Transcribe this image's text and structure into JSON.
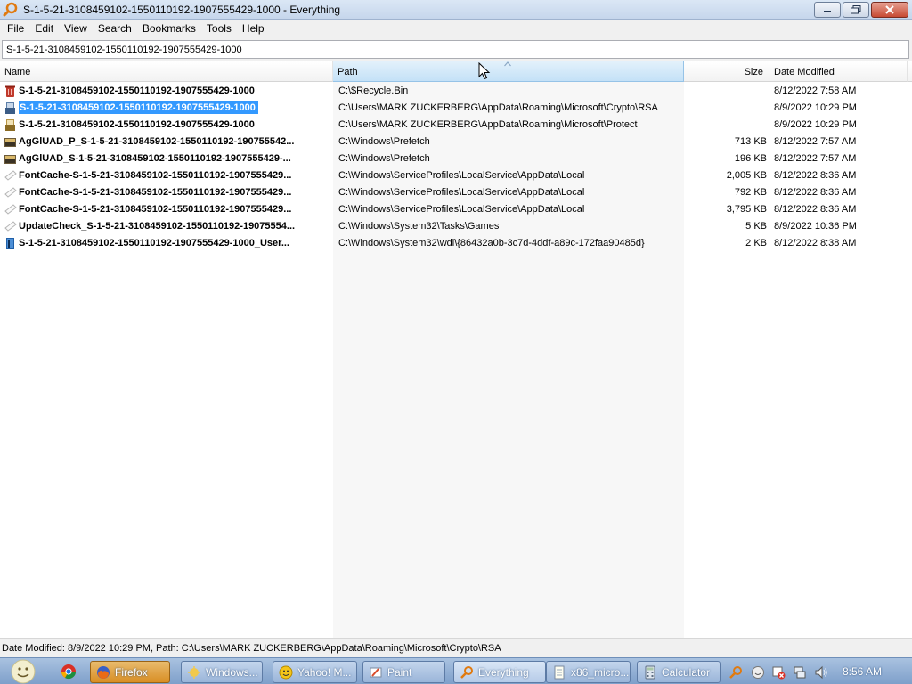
{
  "window": {
    "title": "S-1-5-21-3108459102-1550110192-1907555429-1000 - Everything"
  },
  "menu": [
    "File",
    "Edit",
    "View",
    "Search",
    "Bookmarks",
    "Tools",
    "Help"
  ],
  "search": {
    "value": "S-1-5-21-3108459102-1550110192-1907555429-1000"
  },
  "columns": {
    "name": "Name",
    "path": "Path",
    "size": "Size",
    "date": "Date Modified",
    "sorted_by": "Path"
  },
  "rows": [
    {
      "name": "S-1-5-21-3108459102-1550110192-1907555429-1000",
      "path": "C:\\$Recycle.Bin",
      "size": "",
      "date": "8/12/2022 7:58 AM",
      "icon": "recycle-bin-icon"
    },
    {
      "name": "S-1-5-21-3108459102-1550110192-1907555429-1000",
      "path": "C:\\Users\\MARK ZUCKERBERG\\AppData\\Roaming\\Microsoft\\Crypto\\RSA",
      "size": "",
      "date": "8/9/2022 10:29 PM",
      "icon": "folder-icon",
      "selected": true
    },
    {
      "name": "S-1-5-21-3108459102-1550110192-1907555429-1000",
      "path": "C:\\Users\\MARK ZUCKERBERG\\AppData\\Roaming\\Microsoft\\Protect",
      "size": "",
      "date": "8/9/2022 10:29 PM",
      "icon": "folder-icon"
    },
    {
      "name": "AgGlUAD_P_S-1-5-21-3108459102-1550110192-190755542...",
      "path": "C:\\Windows\\Prefetch",
      "size": "713 KB",
      "date": "8/12/2022 7:57 AM",
      "icon": "prefetch-file-icon"
    },
    {
      "name": "AgGlUAD_S-1-5-21-3108459102-1550110192-1907555429-...",
      "path": "C:\\Windows\\Prefetch",
      "size": "196 KB",
      "date": "8/12/2022 7:57 AM",
      "icon": "prefetch-file-icon"
    },
    {
      "name": "FontCache-S-1-5-21-3108459102-1550110192-1907555429...",
      "path": "C:\\Windows\\ServiceProfiles\\LocalService\\AppData\\Local",
      "size": "2,005 KB",
      "date": "8/12/2022 8:36 AM",
      "icon": "blank-file-icon"
    },
    {
      "name": "FontCache-S-1-5-21-3108459102-1550110192-1907555429...",
      "path": "C:\\Windows\\ServiceProfiles\\LocalService\\AppData\\Local",
      "size": "792 KB",
      "date": "8/12/2022 8:36 AM",
      "icon": "blank-file-icon"
    },
    {
      "name": "FontCache-S-1-5-21-3108459102-1550110192-1907555429...",
      "path": "C:\\Windows\\ServiceProfiles\\LocalService\\AppData\\Local",
      "size": "3,795 KB",
      "date": "8/12/2022 8:36 AM",
      "icon": "blank-file-icon"
    },
    {
      "name": "UpdateCheck_S-1-5-21-3108459102-1550110192-19075554...",
      "path": "C:\\Windows\\System32\\Tasks\\Games",
      "size": "5 KB",
      "date": "8/9/2022 10:36 PM",
      "icon": "blank-file-icon"
    },
    {
      "name": "S-1-5-21-3108459102-1550110192-1907555429-1000_User...",
      "path": "C:\\Windows\\System32\\wdi\\{86432a0b-3c7d-4ddf-a89c-172faa90485d}",
      "size": "2 KB",
      "date": "8/12/2022 8:38 AM",
      "icon": "data-file-icon"
    }
  ],
  "status": {
    "text": "Date Modified: 8/9/2022 10:29 PM, Path: C:\\Users\\MARK ZUCKERBERG\\AppData\\Roaming\\Microsoft\\Crypto\\RSA"
  },
  "taskbar": {
    "tasks": [
      {
        "label": "Firefox",
        "icon": "firefox-icon"
      },
      {
        "label": "Windows...",
        "icon": "windows-explorer-icon"
      },
      {
        "label": "Yahoo! M...",
        "icon": "yahoo-messenger-icon"
      },
      {
        "label": "Paint",
        "icon": "paint-icon"
      },
      {
        "label": "Everything",
        "icon": "everything-icon"
      },
      {
        "label": "x86_micro...",
        "icon": "notepad-icon"
      },
      {
        "label": "Calculator",
        "icon": "calculator-icon"
      }
    ],
    "clock": "8:56 AM"
  },
  "colors": {
    "selection": "#3399ff",
    "active_task": "#d98e24"
  }
}
